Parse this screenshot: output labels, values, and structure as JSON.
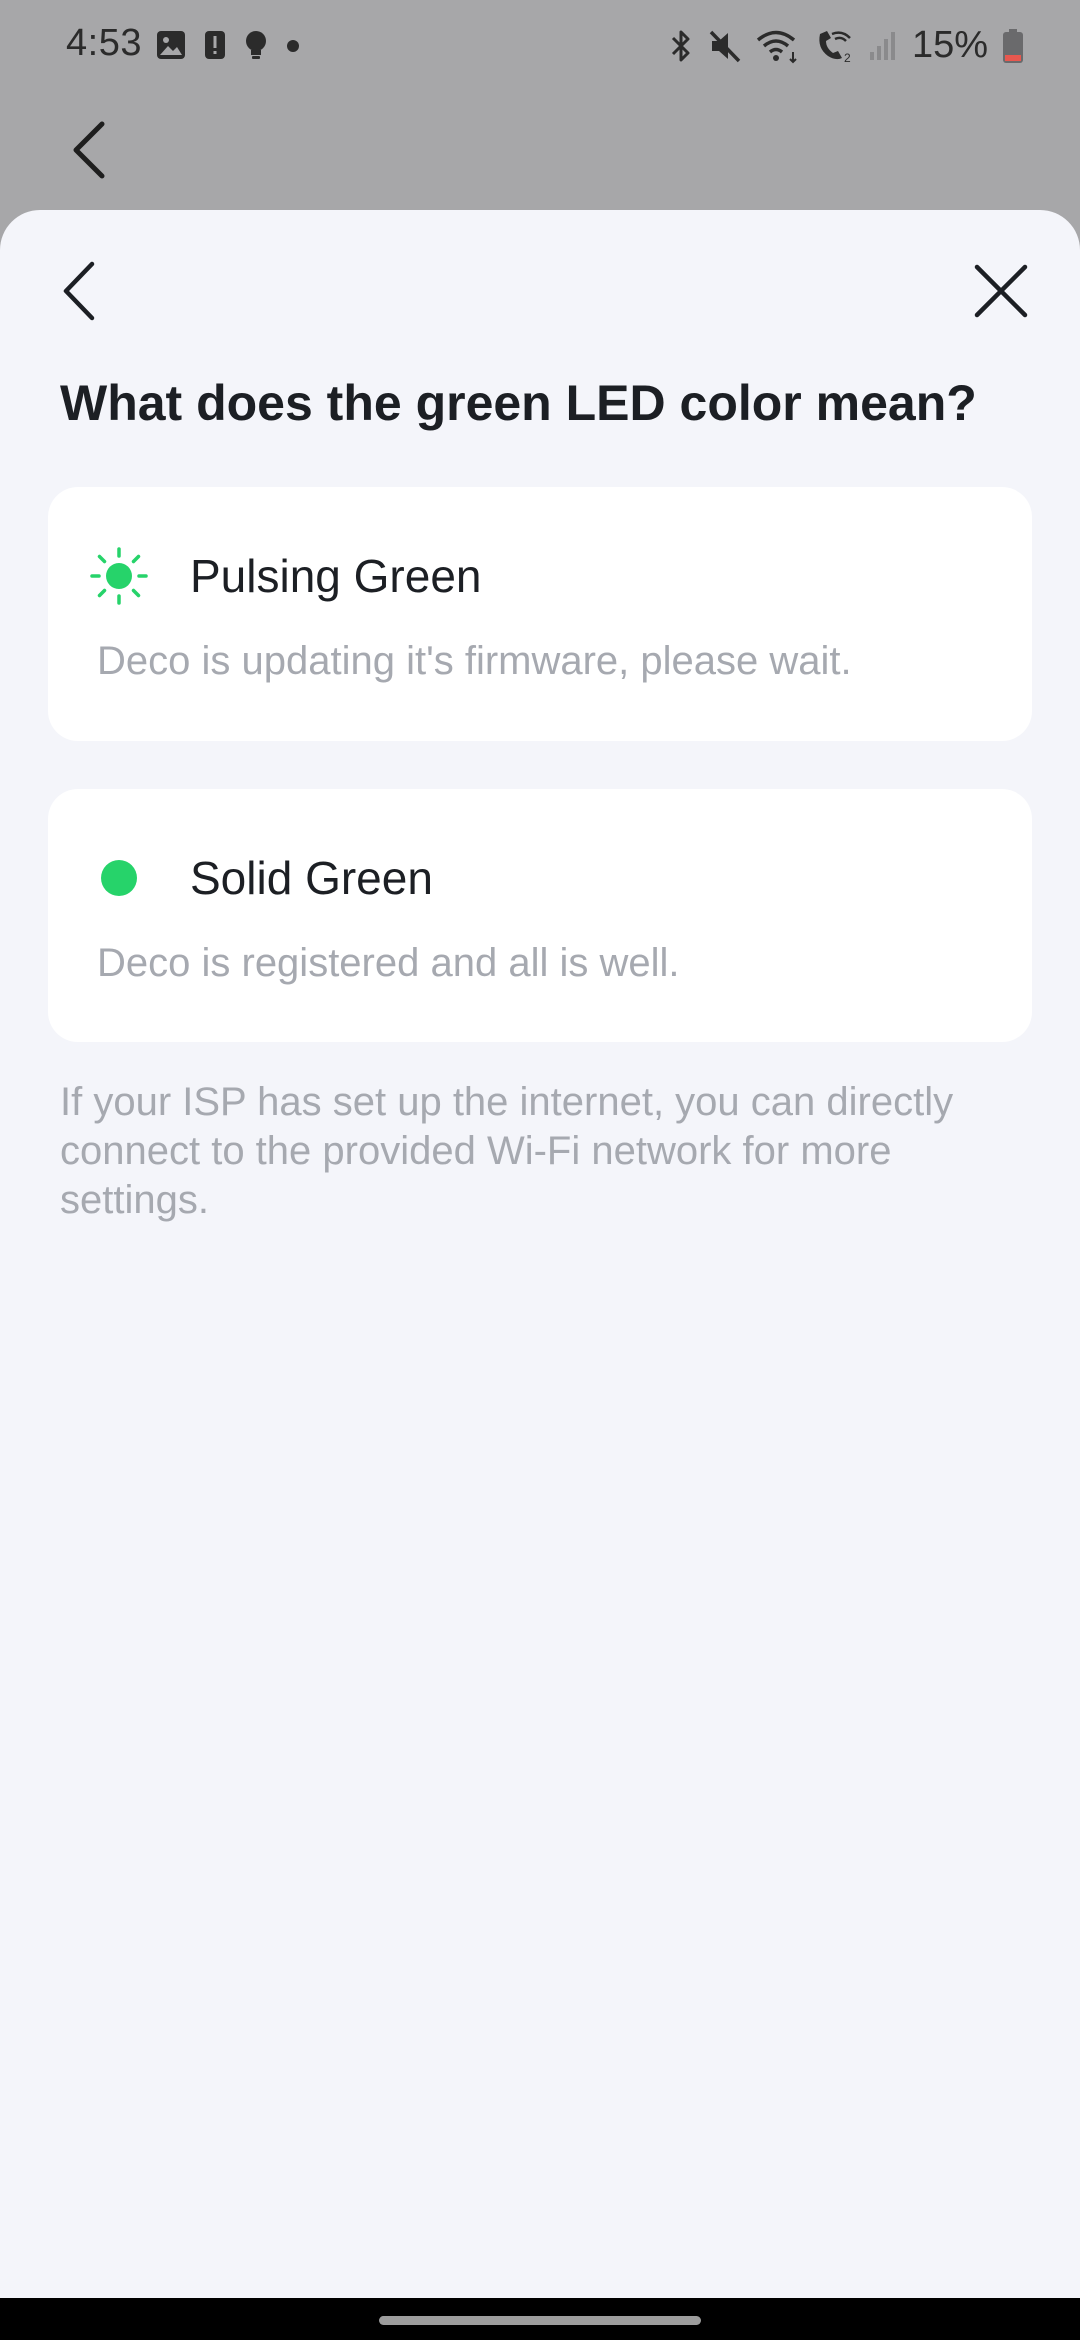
{
  "status_bar": {
    "time": "4:53",
    "battery_percent": "15%",
    "left_icons": [
      "gallery-icon",
      "alert-icon",
      "bulb-icon",
      "dot-icon"
    ],
    "right_icons": [
      "bluetooth-icon",
      "mute-icon",
      "wifi-icon",
      "wifi-call-icon",
      "signal-icon",
      "battery-icon"
    ]
  },
  "sheet": {
    "title": "What does the green LED color mean?",
    "items": [
      {
        "label": "Pulsing Green",
        "description": "Deco is updating it's firmware, please wait.",
        "icon": "pulsing-led-icon",
        "color": "#26d36a"
      },
      {
        "label": "Solid Green",
        "description": "Deco is registered and all is well.",
        "icon": "solid-led-icon",
        "color": "#26d36a"
      }
    ],
    "footnote": "If your ISP has set up the internet, you can directly connect to the provided Wi-Fi network for more settings."
  },
  "colors": {
    "led_green": "#26d36a",
    "battery_low": "#e8584f",
    "sheet_background": "#f4f5fa",
    "card_background": "#ffffff"
  }
}
